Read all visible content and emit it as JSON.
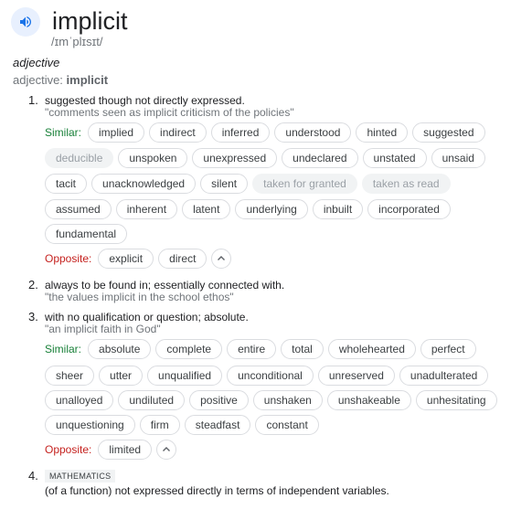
{
  "entry": {
    "word": "implicit",
    "phonetic": "/ɪmˈplɪsɪt/",
    "icon": "speaker-icon",
    "part_of_speech": "adjective",
    "pos_prefix": "adjective: ",
    "pos_word": "implicit"
  },
  "labels": {
    "similar": "Similar:",
    "opposite": "Opposite:"
  },
  "senses": [
    {
      "num": "1.",
      "definition": "suggested though not directly expressed.",
      "example": "\"comments seen as implicit criticism of the policies\"",
      "similar_rows": [
        [
          "implied",
          "indirect",
          "inferred",
          "understood",
          "hinted",
          "suggested"
        ],
        [
          "deducible",
          "unspoken",
          "unexpressed",
          "undeclared",
          "unstated",
          "unsaid"
        ],
        [
          "tacit",
          "unacknowledged",
          "silent",
          "taken for granted",
          "taken as read"
        ],
        [
          "assumed",
          "inherent",
          "latent",
          "underlying",
          "inbuilt",
          "incorporated"
        ],
        [
          "fundamental"
        ]
      ],
      "disabled": [
        "deducible",
        "taken for granted",
        "taken as read"
      ],
      "opposite": [
        "explicit",
        "direct"
      ]
    },
    {
      "num": "2.",
      "definition": "always to be found in; essentially connected with.",
      "example": "\"the values implicit in the school ethos\""
    },
    {
      "num": "3.",
      "definition": "with no qualification or question; absolute.",
      "example": "\"an implicit faith in God\"",
      "similar_rows": [
        [
          "absolute",
          "complete",
          "entire",
          "total",
          "wholehearted",
          "perfect"
        ],
        [
          "sheer",
          "utter",
          "unqualified",
          "unconditional",
          "unreserved",
          "unadulterated"
        ],
        [
          "unalloyed",
          "undiluted",
          "positive",
          "unshaken",
          "unshakeable",
          "unhesitating"
        ],
        [
          "unquestioning",
          "firm",
          "steadfast",
          "constant"
        ]
      ],
      "opposite": [
        "limited"
      ]
    },
    {
      "num": "4.",
      "domain": "MATHEMATICS",
      "definition": "(of a function) not expressed directly in terms of independent variables."
    }
  ]
}
